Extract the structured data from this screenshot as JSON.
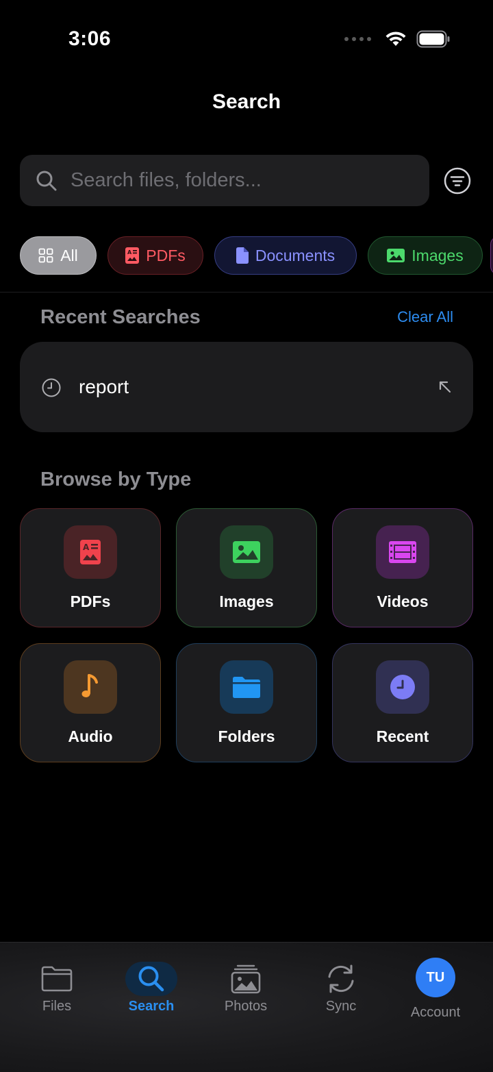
{
  "status_bar": {
    "time": "3:06"
  },
  "header": {
    "title": "Search"
  },
  "search": {
    "placeholder": "Search files, folders..."
  },
  "filter_chips": [
    {
      "label": "All",
      "selected": true
    },
    {
      "label": "PDFs",
      "color": "#ff5a63"
    },
    {
      "label": "Documents",
      "color": "#8a91ff"
    },
    {
      "label": "Images",
      "color": "#4cd96c"
    }
  ],
  "recent_searches": {
    "title": "Recent Searches",
    "clear_label": "Clear All",
    "items": [
      {
        "text": "report"
      }
    ]
  },
  "browse_by_type": {
    "title": "Browse by Type",
    "types": [
      {
        "label": "PDFs",
        "icon": "pdf-icon",
        "color": "#f0424c"
      },
      {
        "label": "Images",
        "icon": "image-icon",
        "color": "#3dd25e"
      },
      {
        "label": "Videos",
        "icon": "film-icon",
        "color": "#d946ef"
      },
      {
        "label": "Audio",
        "icon": "music-note-icon",
        "color": "#f59a32"
      },
      {
        "label": "Folders",
        "icon": "folder-icon",
        "color": "#2196f3"
      },
      {
        "label": "Recent",
        "icon": "clock-icon",
        "color": "#7c7cf5"
      }
    ]
  },
  "tab_bar": {
    "tabs": [
      {
        "label": "Files",
        "icon": "folder-icon"
      },
      {
        "label": "Search",
        "icon": "search-icon",
        "active": true
      },
      {
        "label": "Photos",
        "icon": "photos-icon"
      },
      {
        "label": "Sync",
        "icon": "sync-icon"
      },
      {
        "label": "Account",
        "avatar_initials": "TU"
      }
    ]
  },
  "colors": {
    "accent": "#2a8ff0",
    "background": "#000000",
    "card": "#1c1c1e"
  }
}
